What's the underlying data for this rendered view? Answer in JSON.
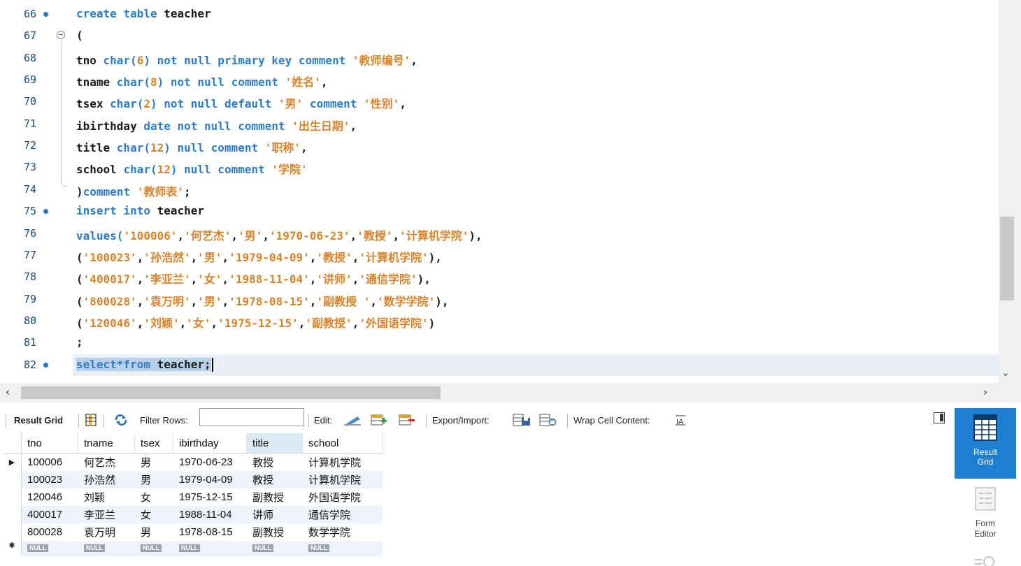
{
  "editor": {
    "lines": [
      {
        "n": "66",
        "marker": true,
        "tokens": [
          [
            "kw",
            "create table "
          ],
          [
            "plain",
            "teacher"
          ]
        ]
      },
      {
        "n": "67",
        "fold": "start",
        "tokens": [
          [
            "plain",
            "("
          ]
        ]
      },
      {
        "n": "68",
        "tokens": [
          [
            "plain",
            "tno "
          ],
          [
            "kw",
            "char("
          ],
          [
            "str",
            "6"
          ],
          [
            "kw",
            ") not null primary key comment "
          ],
          [
            "str",
            "'教师编号'"
          ],
          [
            "plain",
            ","
          ]
        ]
      },
      {
        "n": "69",
        "tokens": [
          [
            "plain",
            "tname "
          ],
          [
            "kw",
            "char("
          ],
          [
            "str",
            "8"
          ],
          [
            "kw",
            ") not null comment "
          ],
          [
            "str",
            "'姓名'"
          ],
          [
            "plain",
            ","
          ]
        ]
      },
      {
        "n": "70",
        "tokens": [
          [
            "plain",
            "tsex "
          ],
          [
            "kw",
            "char("
          ],
          [
            "str",
            "2"
          ],
          [
            "kw",
            ") not null default "
          ],
          [
            "str",
            "'男'"
          ],
          [
            "kw",
            " comment "
          ],
          [
            "str",
            "'性别'"
          ],
          [
            "plain",
            ","
          ]
        ]
      },
      {
        "n": "71",
        "tokens": [
          [
            "plain",
            "ibirthday "
          ],
          [
            "kw",
            "date not null comment "
          ],
          [
            "str",
            "'出生日期'"
          ],
          [
            "plain",
            ","
          ]
        ]
      },
      {
        "n": "72",
        "tokens": [
          [
            "plain",
            "title "
          ],
          [
            "kw",
            "char("
          ],
          [
            "str",
            "12"
          ],
          [
            "kw",
            ") null comment "
          ],
          [
            "str",
            "'职称'"
          ],
          [
            "plain",
            ","
          ]
        ]
      },
      {
        "n": "73",
        "tokens": [
          [
            "plain",
            "school "
          ],
          [
            "kw",
            "char("
          ],
          [
            "str",
            "12"
          ],
          [
            "kw",
            ") null comment "
          ],
          [
            "str",
            "'学院'"
          ]
        ]
      },
      {
        "n": "74",
        "fold": "end",
        "tokens": [
          [
            "plain",
            ")"
          ],
          [
            "kw",
            "comment "
          ],
          [
            "str",
            "'教师表'"
          ],
          [
            "plain",
            ";"
          ]
        ]
      },
      {
        "n": "75",
        "marker": true,
        "tokens": [
          [
            "kw",
            "insert into "
          ],
          [
            "plain",
            "teacher"
          ]
        ]
      },
      {
        "n": "76",
        "tokens": [
          [
            "kw",
            "values("
          ],
          [
            "str",
            "'100006'"
          ],
          [
            "plain",
            ","
          ],
          [
            "str",
            "'何艺杰'"
          ],
          [
            "plain",
            ","
          ],
          [
            "str",
            "'男'"
          ],
          [
            "plain",
            ","
          ],
          [
            "str",
            "'1970-06-23'"
          ],
          [
            "plain",
            ","
          ],
          [
            "str",
            "'教授'"
          ],
          [
            "plain",
            ","
          ],
          [
            "str",
            "'计算机学院'"
          ],
          [
            "plain",
            "),"
          ]
        ]
      },
      {
        "n": "77",
        "tokens": [
          [
            "plain",
            "("
          ],
          [
            "str",
            "'100023'"
          ],
          [
            "plain",
            ","
          ],
          [
            "str",
            "'孙浩然'"
          ],
          [
            "plain",
            ","
          ],
          [
            "str",
            "'男'"
          ],
          [
            "plain",
            ","
          ],
          [
            "str",
            "'1979-04-09'"
          ],
          [
            "plain",
            ","
          ],
          [
            "str",
            "'教授'"
          ],
          [
            "plain",
            ","
          ],
          [
            "str",
            "'计算机学院'"
          ],
          [
            "plain",
            "),"
          ]
        ]
      },
      {
        "n": "78",
        "tokens": [
          [
            "plain",
            "("
          ],
          [
            "str",
            "'400017'"
          ],
          [
            "plain",
            ","
          ],
          [
            "str",
            "'李亚兰'"
          ],
          [
            "plain",
            ","
          ],
          [
            "str",
            "'女'"
          ],
          [
            "plain",
            ","
          ],
          [
            "str",
            "'1988-11-04'"
          ],
          [
            "plain",
            ","
          ],
          [
            "str",
            "'讲师'"
          ],
          [
            "plain",
            ","
          ],
          [
            "str",
            "'通信学院'"
          ],
          [
            "plain",
            "),"
          ]
        ]
      },
      {
        "n": "79",
        "tokens": [
          [
            "plain",
            "("
          ],
          [
            "str",
            "'800028'"
          ],
          [
            "plain",
            ","
          ],
          [
            "str",
            "'袁万明'"
          ],
          [
            "plain",
            ","
          ],
          [
            "str",
            "'男'"
          ],
          [
            "plain",
            ","
          ],
          [
            "str",
            "'1978-08-15'"
          ],
          [
            "plain",
            ","
          ],
          [
            "str",
            "'副教授 '"
          ],
          [
            "plain",
            ","
          ],
          [
            "str",
            "'数学学院'"
          ],
          [
            "plain",
            "),"
          ]
        ]
      },
      {
        "n": "80",
        "tokens": [
          [
            "plain",
            "("
          ],
          [
            "str",
            "'120046'"
          ],
          [
            "plain",
            ","
          ],
          [
            "str",
            "'刘颖'"
          ],
          [
            "plain",
            ","
          ],
          [
            "str",
            "'女'"
          ],
          [
            "plain",
            ","
          ],
          [
            "str",
            "'1975-12-15'"
          ],
          [
            "plain",
            ","
          ],
          [
            "str",
            "'副教授'"
          ],
          [
            "plain",
            ","
          ],
          [
            "str",
            "'外国语学院'"
          ],
          [
            "plain",
            ")"
          ]
        ]
      },
      {
        "n": "81",
        "tokens": [
          [
            "plain",
            ";"
          ]
        ]
      },
      {
        "n": "82",
        "marker": true,
        "current": true,
        "tokens": [
          [
            "kw",
            "select*from "
          ],
          [
            "plain",
            "teacher;"
          ]
        ]
      }
    ]
  },
  "toolbar": {
    "result_grid_label": "Result Grid",
    "filter_rows_label": "Filter Rows:",
    "filter_value": "",
    "edit_label": "Edit:",
    "export_label": "Export/Import:",
    "wrap_label": "Wrap Cell Content:"
  },
  "grid": {
    "columns": [
      "tno",
      "tname",
      "tsex",
      "ibirthday",
      "title",
      "school"
    ],
    "highlight_column": "title",
    "rows": [
      [
        "100006",
        "何艺杰",
        "男",
        "1970-06-23",
        "教授",
        "计算机学院"
      ],
      [
        "100023",
        "孙浩然",
        "男",
        "1979-04-09",
        "教授",
        "计算机学院"
      ],
      [
        "120046",
        "刘颖",
        "女",
        "1975-12-15",
        "副教授",
        "外国语学院"
      ],
      [
        "400017",
        "李亚兰",
        "女",
        "1988-11-04",
        "讲师",
        "通信学院"
      ],
      [
        "800028",
        "袁万明",
        "男",
        "1978-08-15",
        "副教授",
        "数学学院"
      ]
    ],
    "null_label": "NULL"
  },
  "side_panel": {
    "result_grid": "Result Grid",
    "form_editor": "Form Editor"
  },
  "colors": {
    "keyword": "#2c7cc9",
    "string": "#d9832a",
    "accent": "#1c7fd0"
  }
}
